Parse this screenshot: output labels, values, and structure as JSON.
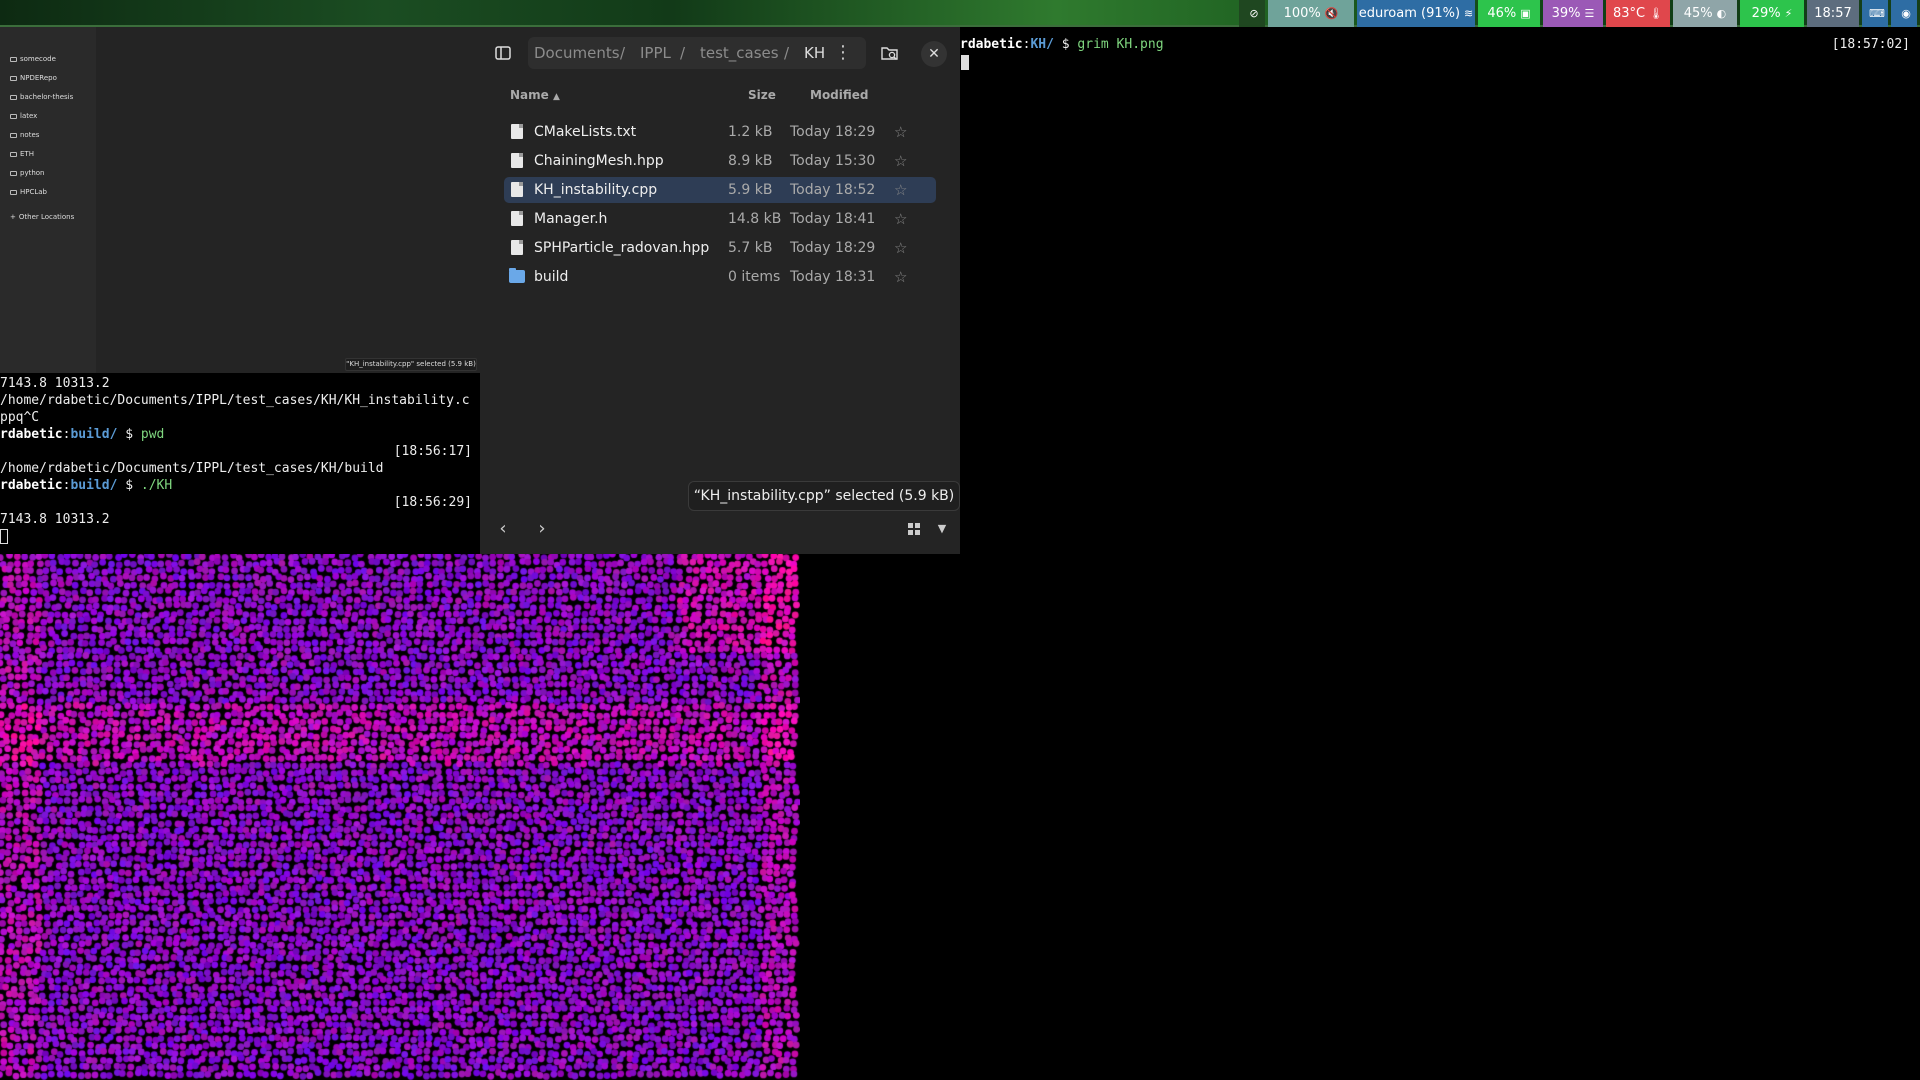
{
  "topbar": {
    "modules": [
      {
        "name": "privacy-icon",
        "text": "",
        "bg": "#1f4720",
        "icon": "eye-off"
      },
      {
        "name": "volume",
        "text": "100%",
        "bg": "#6fa39a",
        "icon": "mute-mic"
      },
      {
        "name": "network",
        "text": "eduroam (91%)",
        "bg": "#2e6da4",
        "icon": "wifi"
      },
      {
        "name": "cpu",
        "text": "46%",
        "bg": "#2dc44c",
        "icon": "chip"
      },
      {
        "name": "memory",
        "text": "39%",
        "bg": "#9b59b6",
        "icon": "bars"
      },
      {
        "name": "temperature",
        "text": "83°C",
        "bg": "#e0474c",
        "icon": "thermo"
      },
      {
        "name": "backlight",
        "text": "45%",
        "bg": "#8fa5a8",
        "icon": "half-circle"
      },
      {
        "name": "battery",
        "text": "29%",
        "bg": "#2dc44c",
        "icon": "plug"
      },
      {
        "name": "clock",
        "text": "18:57",
        "bg": "#5d6d7e",
        "icon": ""
      },
      {
        "name": "keyboard",
        "text": "",
        "bg": "#2e6da4",
        "icon": "keyboard"
      },
      {
        "name": "discord",
        "text": "",
        "bg": "#2e6da4",
        "icon": "discord"
      }
    ]
  },
  "sidebar": {
    "items": [
      "somecode",
      "NPDERepo",
      "bachelor-thesis",
      "latex",
      "notes",
      "ETH",
      "python",
      "HPCLab"
    ],
    "other_locations": "Other Locations",
    "small_toast": "\"KH_instability.cpp\" selected (5.9 kB)"
  },
  "files": {
    "breadcrumbs": [
      "Documents",
      "IPPL",
      "test_cases",
      "KH"
    ],
    "separator": "/",
    "columns": {
      "name": "Name",
      "size": "Size",
      "modified": "Modified"
    },
    "rows": [
      {
        "name": "CMakeLists.txt",
        "size": "1.2 kB",
        "modified": "Today 18:29",
        "type": "file",
        "selected": false
      },
      {
        "name": "ChainingMesh.hpp",
        "size": "8.9 kB",
        "modified": "Today 15:30",
        "type": "file",
        "selected": false
      },
      {
        "name": "KH_instability.cpp",
        "size": "5.9 kB",
        "modified": "Today 18:52",
        "type": "file",
        "selected": true
      },
      {
        "name": "Manager.h",
        "size": "14.8 kB",
        "modified": "Today 18:41",
        "type": "file",
        "selected": false
      },
      {
        "name": "SPHParticle_radovan.hpp",
        "size": "5.7 kB",
        "modified": "Today 18:29",
        "type": "file",
        "selected": false
      },
      {
        "name": "build",
        "size": "0 items",
        "modified": "Today 18:31",
        "type": "folder",
        "selected": false
      }
    ],
    "status": "“KH_instability.cpp” selected  (5.9 kB)"
  },
  "term_left": {
    "lines": [
      "7143.8 10313.2",
      "/home/rdabetic/Documents/IPPL/test_cases/KH/KH_instability.c",
      "ppq^C"
    ],
    "prompt1": {
      "user": "rdabetic",
      "path": "build/",
      "sym": "$",
      "cmd": "pwd",
      "time": "[18:56:17]"
    },
    "out1": "/home/rdabetic/Documents/IPPL/test_cases/KH/build",
    "prompt2": {
      "user": "rdabetic",
      "path": "build/",
      "sym": "$",
      "cmd": "./KH",
      "time": "[18:56:29]"
    },
    "out2": "7143.8 10313.2"
  },
  "term_right": {
    "prompt": {
      "user": "rdabetic",
      "path": "KH/",
      "sym": "$",
      "cmd": "grim KH.png",
      "time": "[18:57:02]"
    }
  }
}
